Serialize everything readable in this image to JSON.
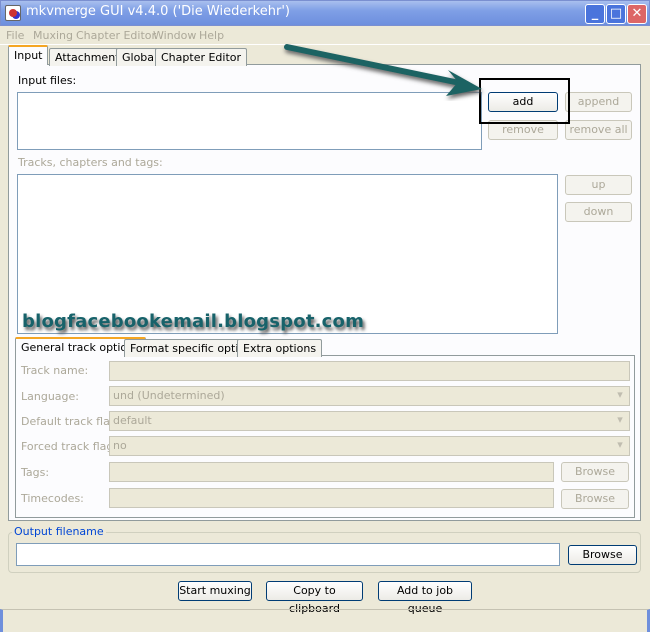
{
  "window": {
    "title": "mkvmerge GUI v4.4.0 ('Die Wiederkehr')",
    "minimize": "_",
    "maximize": "□",
    "close": "✕"
  },
  "menu": [
    "File",
    "Muxing",
    "Chapter Editor",
    "Window",
    "Help"
  ],
  "tabs": [
    "Input",
    "Attachments",
    "Global",
    "Chapter Editor"
  ],
  "input": {
    "input_files_label": "Input files:",
    "add": "add",
    "append": "append",
    "remove": "remove",
    "remove_all": "remove all",
    "tracks_label": "Tracks, chapters and tags:",
    "up": "up",
    "down": "down"
  },
  "watermark": "blogfacebookemail.blogspot.com",
  "subtabs": [
    "General track options",
    "Format specific options",
    "Extra options"
  ],
  "track_options": {
    "track_name_label": "Track name:",
    "track_name": "",
    "language_label": "Language:",
    "language": "und (Undetermined)",
    "default_flag_label": "Default track flag:",
    "default_flag": "default",
    "forced_flag_label": "Forced track flag:",
    "forced_flag": "no",
    "tags_label": "Tags:",
    "tags": "",
    "tags_browse": "Browse",
    "timecodes_label": "Timecodes:",
    "timecodes": "",
    "timecodes_browse": "Browse"
  },
  "output": {
    "label": "Output filename",
    "value": "",
    "browse": "Browse"
  },
  "actions": {
    "start": "Start muxing",
    "copy": "Copy to clipboard",
    "queue": "Add to job queue"
  },
  "colors": {
    "annotation_arrow": "#1a6464",
    "highlight_box": "#000000",
    "group_label": "#0046d5"
  }
}
